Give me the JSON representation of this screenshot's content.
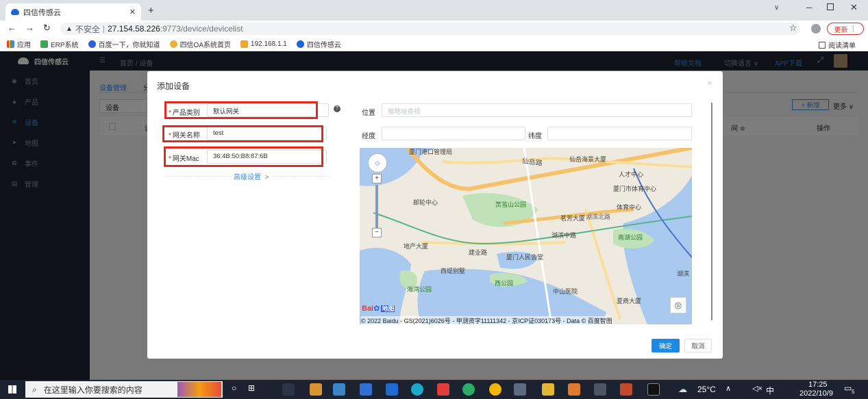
{
  "browser": {
    "tab_title": "四信传感云",
    "url_security": "不安全",
    "url_host": "27.154.58.226",
    "url_rest": ":9773/device/devicelist",
    "update_label": "更新",
    "bookmarks": [
      "应用",
      "ERP系统",
      "百度一下，你就知道",
      "四信OA系统首页",
      "192.168.1.1",
      "四信传感云"
    ],
    "reading_list": "阅读清单"
  },
  "app": {
    "logo": "四信传感云",
    "breadcrumb_home": "首页",
    "breadcrumb_sep": "/",
    "breadcrumb_current": "设备",
    "header_links": [
      "帮助文档",
      "切换语言 ∨",
      "APP下载"
    ],
    "nav": [
      {
        "label": "首页",
        "icon": "dashboard-icon"
      },
      {
        "label": "产品",
        "icon": "product-icon"
      },
      {
        "label": "设备",
        "icon": "device-icon"
      },
      {
        "label": "地图",
        "icon": "map-icon"
      },
      {
        "label": "事件",
        "icon": "event-icon"
      },
      {
        "label": "管理",
        "icon": "manage-icon"
      }
    ],
    "tab_device_mgmt": "设备管理",
    "tab_partial": "分",
    "filter_select": "设备",
    "add_btn": "+ 新增",
    "more_btn": "更多 ∨",
    "table_col_partial": "间 ≑",
    "table_col_op": "操作",
    "table_col_left": "设"
  },
  "dialog": {
    "title": "添加设备",
    "close": "×",
    "fields": {
      "product_category": {
        "label": "产品类别",
        "value": "默认网关"
      },
      "gateway_name": {
        "label": "网关名称",
        "value": "test"
      },
      "gateway_mac": {
        "label": "网关Mac",
        "value": "36:4B:50:B8:87:6B"
      }
    },
    "advanced": "高级设置",
    "advanced_arrow": ">",
    "location_label": "位置",
    "location_placeholder": "按地址查找",
    "lng_label": "经度",
    "lat_label": "纬度",
    "confirm": "确定",
    "cancel": "取消"
  },
  "map": {
    "labels": [
      "厦门港口管理局",
      "仙岳路",
      "仙岳海景大厦",
      "人才中心",
      "厦门市体育中心",
      "邮轮中心",
      "筼筜山公园",
      "体育中心",
      "茗芳大厦",
      "湖滨北路",
      "湖滨中路",
      "南湖公园",
      "地产大厦",
      "建业路",
      "厦门人民会堂",
      "西堤别墅",
      "海湾公园",
      "西公园",
      "中山医院",
      "夏商大厦",
      "湖滨"
    ],
    "copyright": "© 2022 Baidu - GS(2021)6026号 - 甲测资字11111342 - 京ICP证030173号 - Data © 百度智图",
    "baidu_logo": "Bai",
    "baidu_logo_map": "地图"
  },
  "taskbar": {
    "search_placeholder": "在这里输入你要搜索的内容",
    "weather": "25°C",
    "ime": "中",
    "time": "17:25",
    "date": "2022/10/9",
    "notif_count": "5"
  }
}
